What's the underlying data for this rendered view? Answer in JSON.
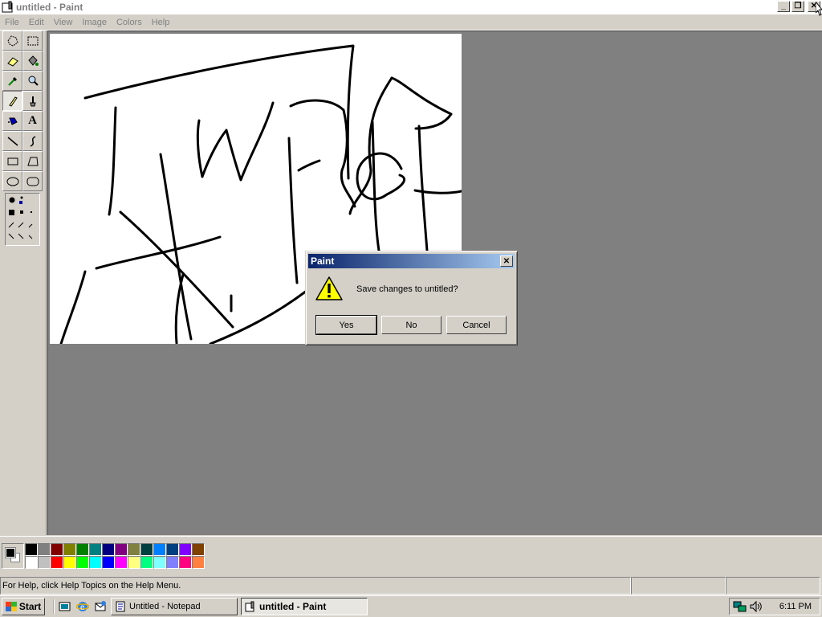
{
  "window": {
    "title": "untitled - Paint",
    "caption_buttons": {
      "minimize": "minimize-icon",
      "restore": "restore-icon",
      "close": "close-icon"
    }
  },
  "menu": [
    "File",
    "Edit",
    "View",
    "Image",
    "Colors",
    "Help"
  ],
  "tools": [
    {
      "name": "free-form-select-tool",
      "icon": "free-select-icon"
    },
    {
      "name": "select-tool",
      "icon": "rect-select-icon"
    },
    {
      "name": "eraser-tool",
      "icon": "eraser-icon"
    },
    {
      "name": "fill-tool",
      "icon": "bucket-icon"
    },
    {
      "name": "pick-color-tool",
      "icon": "eyedropper-icon"
    },
    {
      "name": "magnifier-tool",
      "icon": "magnifier-icon"
    },
    {
      "name": "pencil-tool",
      "icon": "pencil-icon",
      "selected": true
    },
    {
      "name": "brush-tool",
      "icon": "brush-icon"
    },
    {
      "name": "airbrush-tool",
      "icon": "airbrush-icon"
    },
    {
      "name": "text-tool",
      "icon": "text-icon",
      "glyph": "A"
    },
    {
      "name": "line-tool",
      "icon": "line-icon"
    },
    {
      "name": "curve-tool",
      "icon": "curve-icon"
    },
    {
      "name": "rectangle-tool",
      "icon": "rectangle-icon"
    },
    {
      "name": "polygon-tool",
      "icon": "polygon-icon"
    },
    {
      "name": "ellipse-tool",
      "icon": "ellipse-icon"
    },
    {
      "name": "rounded-rectangle-tool",
      "icon": "rounded-rect-icon"
    }
  ],
  "colors": {
    "foreground": "#000000",
    "background": "#ffffff",
    "palette_top": [
      "#000000",
      "#808080",
      "#800000",
      "#808000",
      "#008000",
      "#008080",
      "#000080",
      "#800080",
      "#808040",
      "#004040",
      "#0080ff",
      "#004080",
      "#8000ff",
      "#804000"
    ],
    "palette_bottom": [
      "#ffffff",
      "#c0c0c0",
      "#ff0000",
      "#ffff00",
      "#00ff00",
      "#00ffff",
      "#0000ff",
      "#ff00ff",
      "#ffff80",
      "#00ff80",
      "#80ffff",
      "#8080ff",
      "#ff0080",
      "#ff8040"
    ]
  },
  "status": {
    "help_text": "For Help, click Help Topics on the Help Menu."
  },
  "dialog": {
    "title": "Paint",
    "icon": "warning-icon",
    "message": "Save changes to untitled?",
    "buttons": {
      "yes": "Yes",
      "no": "No",
      "cancel": "Cancel"
    },
    "close_icon": "close-icon"
  },
  "taskbar": {
    "start_label": "Start",
    "quick_launch": [
      "show-desktop-icon",
      "internet-explorer-icon",
      "outlook-express-icon"
    ],
    "tasks": [
      {
        "label": "Untitled - Notepad",
        "icon": "notepad-icon",
        "active": false
      },
      {
        "label": "untitled - Paint",
        "icon": "paint-icon",
        "active": true
      }
    ],
    "tray_icons": [
      "network-icon",
      "volume-icon"
    ],
    "clock": "6:11 PM"
  }
}
